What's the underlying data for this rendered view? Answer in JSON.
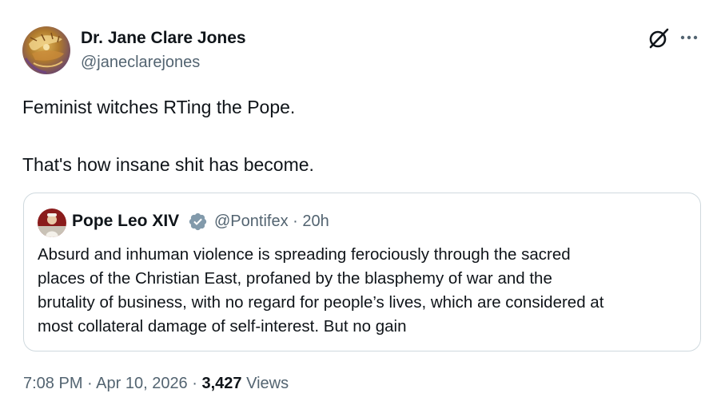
{
  "author": {
    "name": "Dr. Jane Clare Jones",
    "handle": "@janeclarejones",
    "avatar_icon": "ornate-gold-avatar"
  },
  "actions": {
    "grok_icon": "grok-icon",
    "more_icon": "more-icon"
  },
  "tweet": {
    "line1": "Feminist witches RTing the Pope.",
    "line2": "That's how insane shit has become."
  },
  "quote": {
    "name": "Pope Leo XIV",
    "verified_icon": "verified-badge-icon",
    "verified_color": "#829aab",
    "handle_time": "@Pontifex · 20h",
    "lines": [
      "Absurd and inhuman violence is spreading ferociously through the sacred",
      "places of the Christian East, profaned by the blasphemy of war and the",
      "brutality of business, with no regard for people’s lives, which are considered at",
      "most collateral damage of self-interest. But no gain"
    ]
  },
  "meta": {
    "timestamp": "7:08 PM · Apr 10, 2026 · ",
    "views_count": "3,427",
    "views_label": " Views"
  },
  "colors": {
    "text_primary": "#0f1419",
    "text_secondary": "#536471",
    "border": "#cfd9de"
  }
}
